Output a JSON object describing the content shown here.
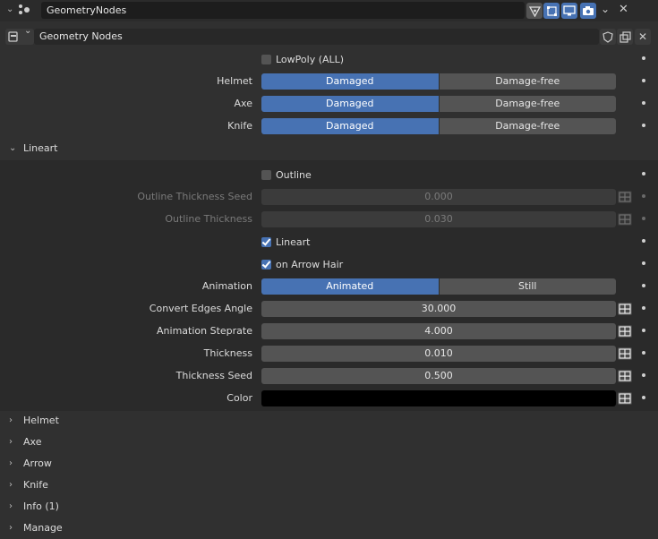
{
  "modifier": {
    "name": "GeometryNodes",
    "node_group": "Geometry Nodes"
  },
  "icons": {
    "wrench": "geometry-nodes-modifier-icon",
    "edit_mode": "edit-mode-icon",
    "on_cage": "on-cage-icon",
    "realtime": "realtime-viewport-icon",
    "render": "render-icon",
    "dropdown": "chevron-down-icon",
    "remove": "close-icon",
    "fake_user": "shield-icon",
    "duplicate": "duplicate-icon",
    "unlink": "close-icon"
  },
  "colors": {
    "accent": "#4772b3",
    "background": "#303030",
    "field": "#545454"
  },
  "rows": {
    "lowpoly": {
      "label": "LowPoly (ALL)",
      "checked": false
    },
    "helmet": {
      "label": "Helmet",
      "options": [
        "Damaged",
        "Damage-free"
      ],
      "selected": "Damaged"
    },
    "axe": {
      "label": "Axe",
      "options": [
        "Damaged",
        "Damage-free"
      ],
      "selected": "Damaged"
    },
    "knife": {
      "label": "Knife",
      "options": [
        "Damaged",
        "Damage-free"
      ],
      "selected": "Damaged"
    }
  },
  "lineart_panel": {
    "title": "Lineart",
    "outline": {
      "label": "Outline",
      "checked": false
    },
    "outline_thickness_seed": {
      "label": "Outline Thickness Seed",
      "value": "0.000"
    },
    "outline_thickness": {
      "label": "Outline Thickness",
      "value": "0.030"
    },
    "lineart": {
      "label": "Lineart",
      "checked": true
    },
    "on_arrow_hair": {
      "label": "on Arrow Hair",
      "checked": true
    },
    "animation": {
      "label": "Animation",
      "options": [
        "Animated",
        "Still"
      ],
      "selected": "Animated"
    },
    "convert_edges_angle": {
      "label": "Convert Edges Angle",
      "value": "30.000"
    },
    "animation_steprate": {
      "label": "Animation Steprate",
      "value": "4.000"
    },
    "thickness": {
      "label": "Thickness",
      "value": "0.010"
    },
    "thickness_seed": {
      "label": "Thickness Seed",
      "value": "0.500"
    },
    "color": {
      "label": "Color",
      "value": "#000000"
    }
  },
  "collapsed_panels": [
    "Helmet",
    "Axe",
    "Arrow",
    "Knife",
    "Info (1)",
    "Manage"
  ]
}
